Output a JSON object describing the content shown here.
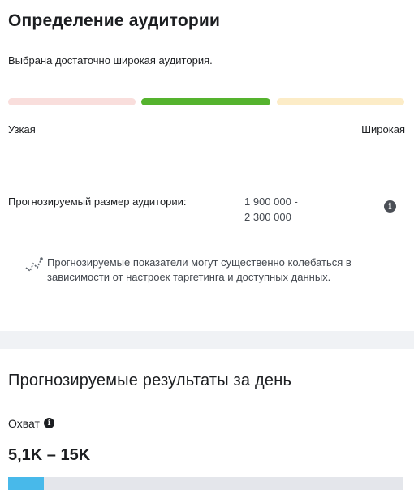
{
  "audience": {
    "title": "Определение аудитории",
    "status": "Выбрана достаточно широкая аудитория.",
    "meter": {
      "active_segment": "middle",
      "colors": {
        "narrow": "#f9dedc",
        "middle": "#55b32e",
        "wide": "#fcecc7"
      },
      "label_narrow": "Узкая",
      "label_wide": "Широкая"
    },
    "size": {
      "label": "Прогнозируемый размер аудитории:",
      "value_line1": "1 900 000 -",
      "value_line2": "2 300 000",
      "info_icon": "info-icon"
    },
    "note": {
      "icon": "trend-icon",
      "text": "Прогнозируемые показатели могут существенно колебаться в зависимости от настроек таргетинга и доступных данных."
    }
  },
  "results": {
    "title": "Прогнозируемые результаты за день",
    "reach": {
      "label": "Охват",
      "info_icon": "info-icon",
      "value": "5,1K – 15K",
      "progress_fraction": 0.09,
      "progress_color": "#48b9ea"
    }
  }
}
